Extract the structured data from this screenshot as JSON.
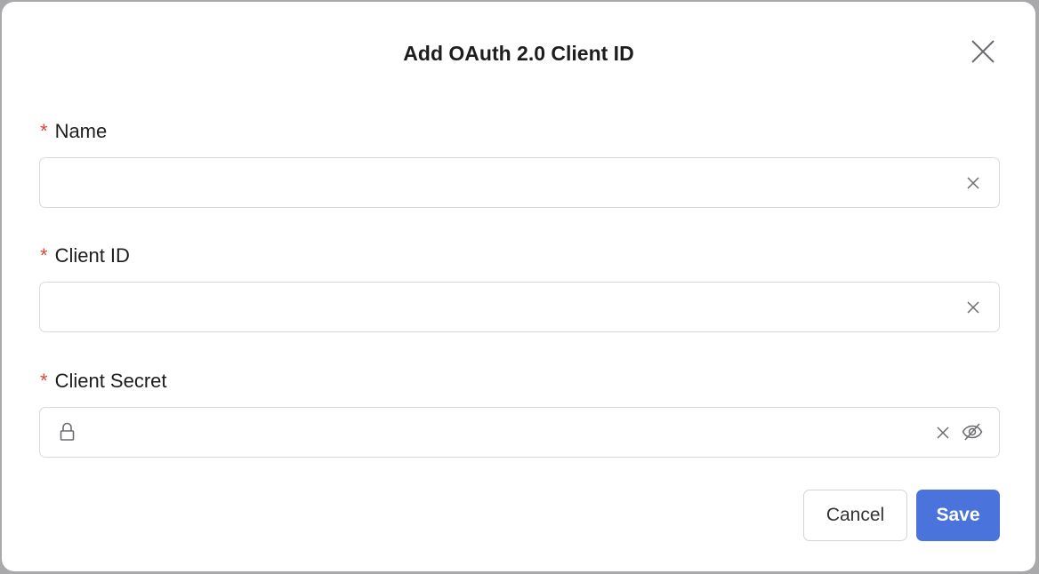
{
  "dialog": {
    "title": "Add OAuth 2.0 Client ID",
    "fields": [
      {
        "label": "Name",
        "required_mark": "*",
        "value": "",
        "placeholder": ""
      },
      {
        "label": "Client ID",
        "required_mark": "*",
        "value": "",
        "placeholder": ""
      },
      {
        "label": "Client Secret",
        "required_mark": "*",
        "value": "",
        "placeholder": ""
      }
    ],
    "cancel_label": "Cancel",
    "save_label": "Save"
  },
  "colors": {
    "accent": "#4a74db",
    "required": "#d9473a"
  }
}
